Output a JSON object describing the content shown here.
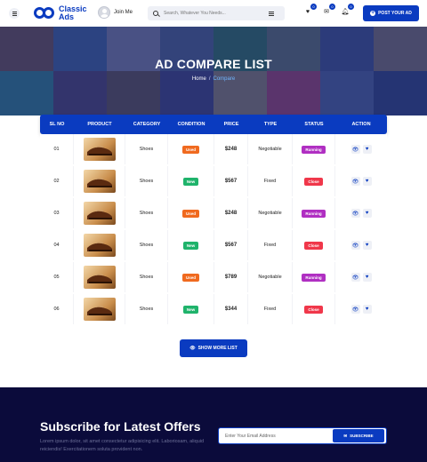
{
  "header": {
    "logo_text_line1": "Classic",
    "logo_text_line2": "Ads",
    "user_name": "Join Me",
    "search_placeholder": "Search, Whatever You Needs...",
    "icons": [
      {
        "name": "heart-icon",
        "glyph": "♥",
        "count": "0"
      },
      {
        "name": "message-icon",
        "glyph": "✉",
        "count": "0"
      },
      {
        "name": "bell-icon",
        "glyph": "🔔︎",
        "count": "0"
      }
    ],
    "post_button": "POST YOUR AD",
    "brand_color": "#0a3bc0"
  },
  "hero": {
    "title": "AD COMPARE LIST",
    "breadcrumb": [
      "Home",
      "Compare"
    ]
  },
  "table": {
    "columns": [
      "SL NO",
      "PRODUCT",
      "CATEGORY",
      "CONDITION",
      "PRICE",
      "TYPE",
      "STATUS",
      "ACTION"
    ],
    "rows": [
      {
        "sl": "01",
        "category": "Shoes",
        "condition": "Used",
        "price": "$248",
        "type": "Negotiable",
        "status": "Running"
      },
      {
        "sl": "02",
        "category": "Shoes",
        "condition": "New",
        "price": "$567",
        "type": "Fixed",
        "status": "Close"
      },
      {
        "sl": "03",
        "category": "Shoes",
        "condition": "Used",
        "price": "$248",
        "type": "Negotiable",
        "status": "Running"
      },
      {
        "sl": "04",
        "category": "Shoes",
        "condition": "New",
        "price": "$567",
        "type": "Fixed",
        "status": "Close"
      },
      {
        "sl": "05",
        "category": "Shoes",
        "condition": "Used",
        "price": "$789",
        "type": "Negotiable",
        "status": "Running"
      },
      {
        "sl": "06",
        "category": "Shoes",
        "condition": "New",
        "price": "$344",
        "type": "Fixed",
        "status": "Close"
      }
    ],
    "colors": {
      "Used": "#f06a1f",
      "New": "#1fb36b",
      "Running": "#b02fc2",
      "Close": "#f0374a"
    }
  },
  "more_button": "SHOW MORE LIST",
  "subscribe": {
    "title": "Subscribe for Latest Offers",
    "text": "Lorem ipsum dolor, sit amet consectetur adipisicing elit. Laboriosam, aliquid reiciendis! Exercitationem soluta provident non.",
    "email_placeholder": "Enter Your Email Address",
    "button": "SUBSCRIBE"
  }
}
